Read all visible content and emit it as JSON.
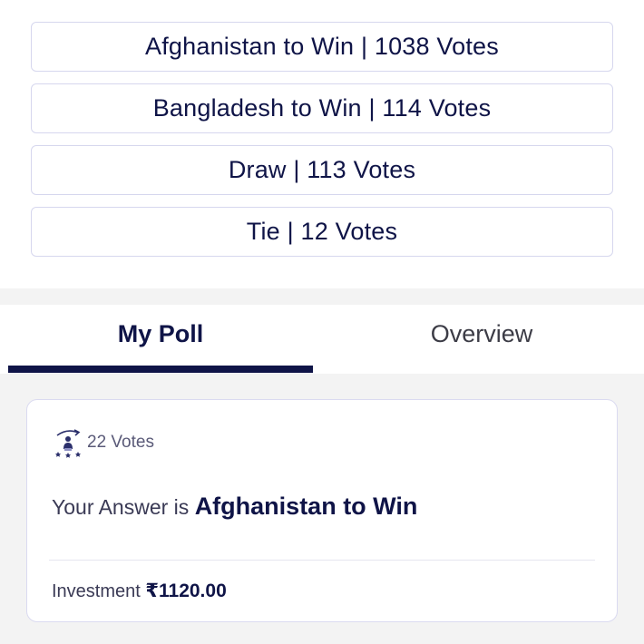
{
  "options": [
    {
      "label": "Afghanistan to Win | 1038 Votes"
    },
    {
      "label": "Bangladesh to Win | 114 Votes"
    },
    {
      "label": "Draw | 113 Votes"
    },
    {
      "label": "Tie | 12 Votes"
    }
  ],
  "tabs": {
    "my_poll": "My Poll",
    "overview": "Overview",
    "active": "My Poll"
  },
  "card": {
    "votes_icon": "voter-trophy-icon",
    "votes": "22 Votes",
    "answer_prefix": "Your Answer is ",
    "answer_value": "Afghanistan to Win",
    "investment_label": "Investment ",
    "investment_value": "₹1120.00"
  },
  "colors": {
    "primary": "#0f1447",
    "border": "#d6d7ee",
    "background_grey": "#f3f3f3"
  }
}
